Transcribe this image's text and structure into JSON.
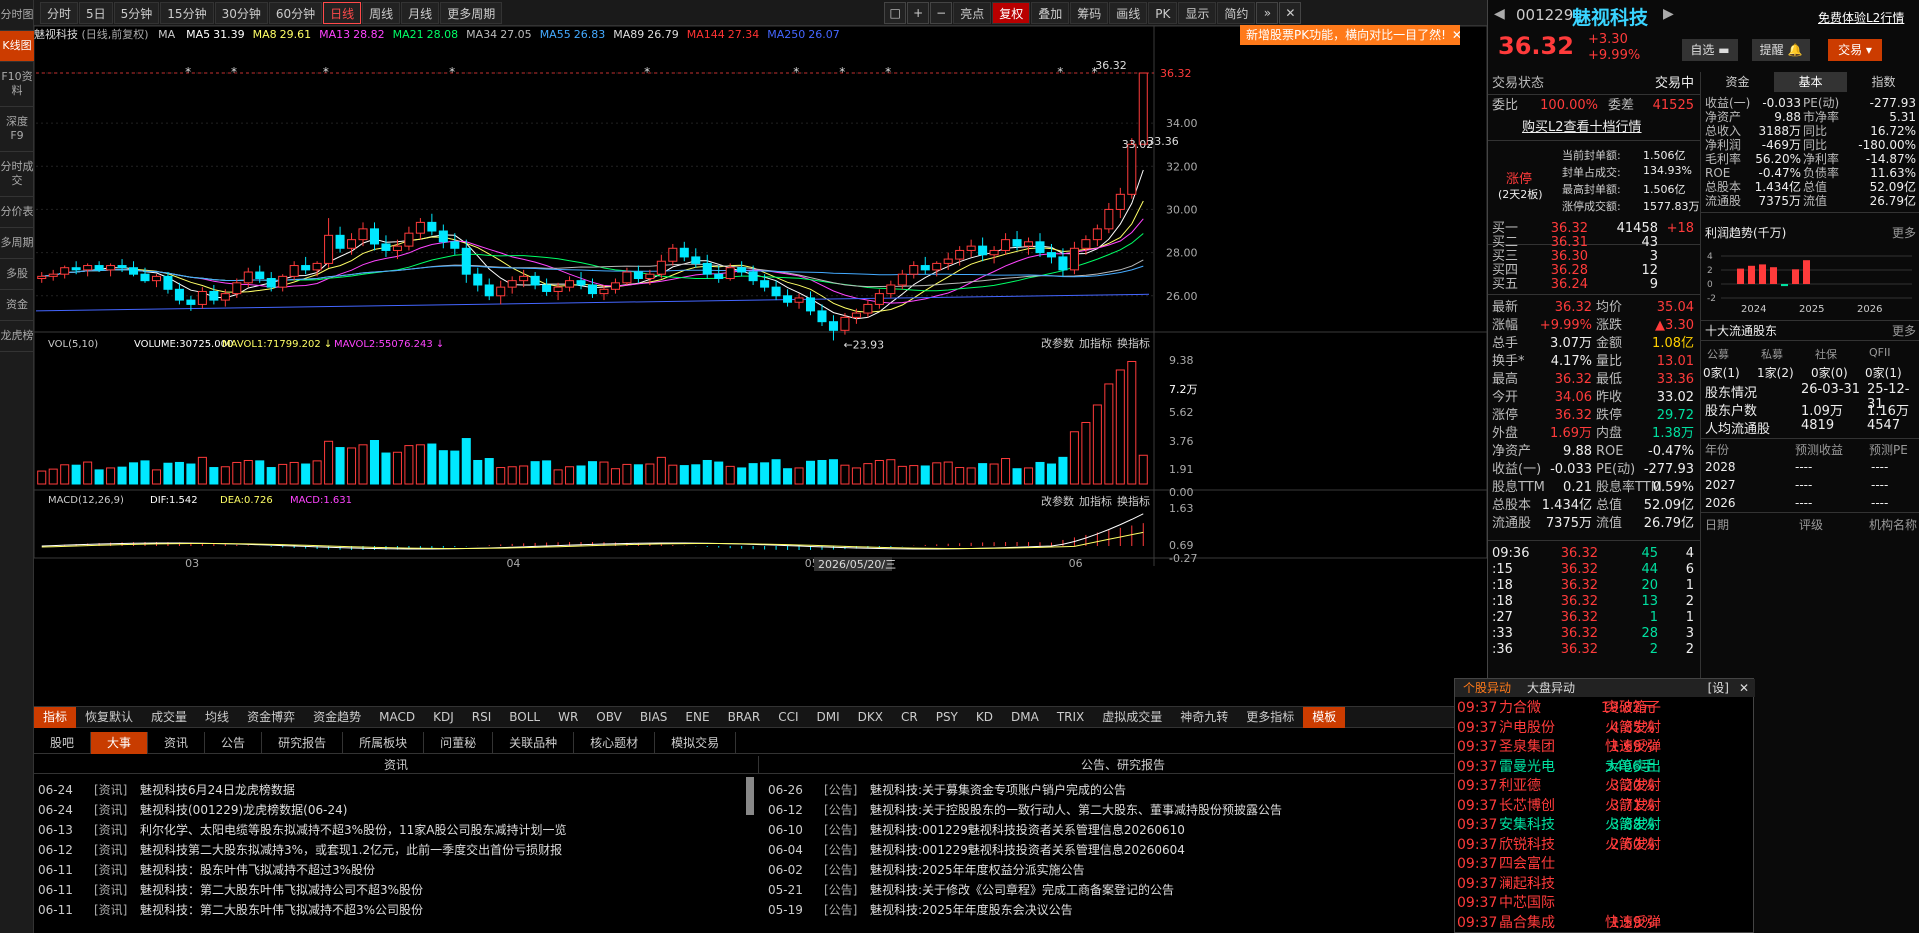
{
  "left_nav": [
    "分时图",
    "K线图",
    "F10资料",
    "深度F9",
    "分时成交",
    "分价表",
    "多周期",
    "多股",
    "资金",
    "龙虎榜"
  ],
  "toolbar": {
    "periods": [
      "分时",
      "5日",
      "5分钟",
      "15分钟",
      "30分钟",
      "60分钟",
      "日线",
      "周线",
      "月线",
      "更多周期"
    ],
    "tools": [
      "亮点",
      "复权",
      "叠加",
      "筹码",
      "画线",
      "PK",
      "显示",
      "简约"
    ]
  },
  "stock": {
    "code": "001229",
    "name": "魅视科技",
    "price": "36.32",
    "change": "+3.30",
    "pct": "+9.99%",
    "trial_link": "免费体验L2行情",
    "watch_btn": "自选",
    "remind_btn": "提醒",
    "trade_btn": "交易"
  },
  "header": {
    "title": "魅视科技",
    "subtitle": "(日线,前复权)",
    "ma": [
      {
        "name": "MA",
        "value": "",
        "color": "#cccccc"
      },
      {
        "name": "MA5",
        "value": "31.39",
        "color": "#ffffff"
      },
      {
        "name": "MA8",
        "value": "29.61",
        "color": "#ffff66"
      },
      {
        "name": "MA13",
        "value": "28.82",
        "color": "#ff44ff"
      },
      {
        "name": "MA21",
        "value": "28.08",
        "color": "#00ff66"
      },
      {
        "name": "MA34",
        "value": "27.05",
        "color": "#bbbbbb"
      },
      {
        "name": "MA55",
        "value": "26.83",
        "color": "#44aaff"
      },
      {
        "name": "MA89",
        "value": "26.79",
        "color": "#dddddd"
      },
      {
        "name": "MA144",
        "value": "27.34",
        "color": "#ff3333"
      },
      {
        "name": "MA250",
        "value": "26.07",
        "color": "#4466ff"
      }
    ],
    "pk_tip": "新增股票PK功能，横向对比一目了然!"
  },
  "colors": {
    "up": "#ff3b3b",
    "down": "#00e8ff",
    "bg": "#000000",
    "accent": "#cc3c00"
  },
  "chart_data": [
    {
      "type": "candlestick",
      "ylim": [
        24.6,
        37.2
      ],
      "yticks": [
        "36.32",
        "34.00",
        "32.00",
        "30.00",
        "28.00",
        "26.00"
      ],
      "annotations": [
        "36.32",
        "33.02",
        "33.36",
        "23.93"
      ],
      "xticks": [
        "03",
        "04",
        "05",
        "06",
        "2026/05/20/三"
      ],
      "ohlc": [
        [
          26.8,
          27.1,
          26.6,
          26.9
        ],
        [
          26.9,
          27.2,
          26.7,
          27
        ],
        [
          27,
          27.4,
          26.8,
          27.3
        ],
        [
          27.3,
          27.6,
          27,
          27.2
        ],
        [
          27.2,
          27.5,
          26.9,
          27.4
        ],
        [
          27.4,
          27.6,
          27.1,
          27.2
        ],
        [
          27.2,
          27.5,
          26.9,
          27.4
        ],
        [
          27.4,
          27.7,
          27.1,
          27.3
        ],
        [
          27.3,
          27.6,
          26.9,
          27
        ],
        [
          27,
          27.3,
          26.6,
          26.7
        ],
        [
          26.7,
          27,
          26.4,
          26.9
        ],
        [
          26.9,
          27.1,
          26.1,
          26.3
        ],
        [
          26.3,
          26.6,
          25.6,
          25.8
        ],
        [
          25.8,
          26,
          25.3,
          25.6
        ],
        [
          25.6,
          26.4,
          25.4,
          26.2
        ],
        [
          26.2,
          26.5,
          25.6,
          25.8
        ],
        [
          25.8,
          26.3,
          25.5,
          26.1
        ],
        [
          26.1,
          26.8,
          25.9,
          26.6
        ],
        [
          26.6,
          27.3,
          26.4,
          27.1
        ],
        [
          27.1,
          27.4,
          26.6,
          26.8
        ],
        [
          26.8,
          27.1,
          26.2,
          26.4
        ],
        [
          26.4,
          27,
          26.2,
          26.9
        ],
        [
          26.9,
          27.6,
          26.7,
          27.4
        ],
        [
          27.4,
          27.8,
          27,
          27.2
        ],
        [
          27.2,
          27.6,
          26.9,
          27.5
        ],
        [
          27.5,
          29.6,
          27.3,
          28.8
        ],
        [
          28.8,
          29.2,
          28,
          28.2
        ],
        [
          28.2,
          28.9,
          27.9,
          28.6
        ],
        [
          28.6,
          29.4,
          28.3,
          29.1
        ],
        [
          29.1,
          29.4,
          28.1,
          28.4
        ],
        [
          28.4,
          28.8,
          27.8,
          28.1
        ],
        [
          28.1,
          28.6,
          27.7,
          28.3
        ],
        [
          28.3,
          29.2,
          28.1,
          28.9
        ],
        [
          28.9,
          29.6,
          28.6,
          29.4
        ],
        [
          29.4,
          29.8,
          28.8,
          29
        ],
        [
          29,
          29.3,
          28.2,
          28.5
        ],
        [
          28.5,
          28.9,
          27.9,
          28.2
        ],
        [
          28.2,
          28.6,
          26.6,
          27
        ],
        [
          27,
          27.3,
          26.2,
          26.5
        ],
        [
          26.5,
          26.8,
          25.8,
          26
        ],
        [
          26,
          26.7,
          25.6,
          26.4
        ],
        [
          26.4,
          26.9,
          26.1,
          26.7
        ],
        [
          26.7,
          27.2,
          26.4,
          26.9
        ],
        [
          26.9,
          27.1,
          26.3,
          26.5
        ],
        [
          26.5,
          26.8,
          26,
          26.2
        ],
        [
          26.2,
          26.6,
          25.8,
          26.4
        ],
        [
          26.4,
          26.9,
          26.2,
          26.7
        ],
        [
          26.7,
          27.1,
          26.3,
          26.5
        ],
        [
          26.5,
          26.8,
          25.9,
          26.1
        ],
        [
          26.1,
          26.5,
          25.8,
          26.3
        ],
        [
          26.3,
          26.8,
          26.1,
          26.6
        ],
        [
          26.6,
          27.3,
          26.5,
          27.1
        ],
        [
          27.1,
          27.4,
          26.6,
          26.8
        ],
        [
          26.8,
          27.2,
          26.5,
          27
        ],
        [
          27,
          27.9,
          26.8,
          27.6
        ],
        [
          27.6,
          28.4,
          27.4,
          28.2
        ],
        [
          28.2,
          28.5,
          27.6,
          27.8
        ],
        [
          27.8,
          28.2,
          27.3,
          27.5
        ],
        [
          27.5,
          27.9,
          26.8,
          27
        ],
        [
          27,
          27.4,
          26.6,
          26.8
        ],
        [
          26.8,
          27.5,
          26.7,
          27.3
        ],
        [
          27.3,
          27.6,
          26.9,
          27.1
        ],
        [
          27.1,
          27.4,
          26.5,
          26.7
        ],
        [
          26.7,
          27,
          26.2,
          26.4
        ],
        [
          26.4,
          26.7,
          25.8,
          26
        ],
        [
          26,
          26.3,
          25.5,
          25.7
        ],
        [
          25.7,
          26.1,
          25.4,
          25.9
        ],
        [
          25.9,
          26.2,
          25.1,
          25.3
        ],
        [
          25.3,
          25.6,
          24.6,
          24.8
        ],
        [
          24.8,
          25.1,
          23.93,
          24.4
        ],
        [
          24.4,
          25.2,
          24.2,
          25
        ],
        [
          25,
          25.4,
          24.7,
          25.2
        ],
        [
          25.2,
          25.8,
          25,
          25.6
        ],
        [
          25.6,
          26.3,
          25.4,
          26.1
        ],
        [
          26.1,
          26.7,
          25.9,
          26.5
        ],
        [
          26.5,
          27.2,
          26.3,
          27
        ],
        [
          27,
          27.6,
          26.8,
          27.4
        ],
        [
          27.4,
          27.8,
          27,
          27.2
        ],
        [
          27.2,
          27.6,
          26.9,
          27.5
        ],
        [
          27.5,
          28,
          27.2,
          27.7
        ],
        [
          27.7,
          28.3,
          27.4,
          28.1
        ],
        [
          28.1,
          28.6,
          27.8,
          28.3
        ],
        [
          28.3,
          28.7,
          27.6,
          27.9
        ],
        [
          27.9,
          28.3,
          27.5,
          28.1
        ],
        [
          28.1,
          28.9,
          27.9,
          28.6
        ],
        [
          28.6,
          29,
          28.1,
          28.3
        ],
        [
          28.3,
          28.7,
          27.9,
          28.5
        ],
        [
          28.5,
          28.9,
          27.8,
          28
        ],
        [
          28,
          28.4,
          27.5,
          27.8
        ],
        [
          27.8,
          28.2,
          26.9,
          27.2
        ],
        [
          27.2,
          28.5,
          27,
          28.2
        ],
        [
          28.2,
          28.8,
          27.9,
          28.6
        ],
        [
          28.6,
          29.3,
          28.3,
          29.1
        ],
        [
          29.1,
          30.3,
          28.9,
          30
        ],
        [
          30,
          31,
          29.6,
          30.7
        ],
        [
          30.7,
          33.3,
          30.5,
          33.02
        ],
        [
          33.02,
          36.32,
          33.02,
          36.32
        ]
      ]
    },
    {
      "type": "bar",
      "title": "VOL(5,10)",
      "series": [
        {
          "name": "VOLUME",
          "value": "30725.000"
        },
        {
          "name": "MAVOL1",
          "value": "71799.202"
        },
        {
          "name": "MAVOL2",
          "value": "55076.243"
        }
      ],
      "yticks": [
        "9.38",
        "7.2万",
        "5.62",
        "3.76",
        "1.91",
        "0.00"
      ]
    },
    {
      "type": "line",
      "title": "MACD(12,26,9)",
      "series": [
        {
          "name": "DIF",
          "value": "1.542"
        },
        {
          "name": "DEA",
          "value": "0.726"
        },
        {
          "name": "MACD",
          "value": "1.631"
        }
      ],
      "yticks": [
        "1.63",
        "0.69",
        "-0.27"
      ]
    }
  ],
  "pane_tools": [
    "改参数",
    "加指标",
    "换指标"
  ],
  "indicator_tabs": [
    "指标",
    "恢复默认",
    "成交量",
    "均线",
    "资金博弈",
    "资金趋势",
    "MACD",
    "KDJ",
    "RSI",
    "BOLL",
    "WR",
    "OBV",
    "BIAS",
    "ENE",
    "BRAR",
    "CCI",
    "DMI",
    "DKX",
    "CR",
    "PSY",
    "KD",
    "DMA",
    "TRIX",
    "虚拟成交量",
    "神奇九转",
    "更多指标",
    "模板"
  ],
  "bottom_tabs": [
    "股吧",
    "大事",
    "资讯",
    "公告",
    "研究报告",
    "所属板块",
    "问董秘",
    "关联品种",
    "核心题材",
    "模拟交易"
  ],
  "news_header": "资讯",
  "notice_header": "公告、研究报告",
  "notice_filter": "公告",
  "news": [
    [
      "06-24",
      "[资讯]",
      "魅视科技6月24日龙虎榜数据"
    ],
    [
      "06-24",
      "[资讯]",
      "魅视科技(001229)龙虎榜数据(06-24)"
    ],
    [
      "06-13",
      "[资讯]",
      "利尔化学、太阳电缆等股东拟减持不超3%股份，11家A股公司股东减持计划一览"
    ],
    [
      "06-12",
      "[资讯]",
      "魅视科技第二大股东拟减持3%，或套现1.2亿元，此前一季度交出首份亏损财报"
    ],
    [
      "06-11",
      "[资讯]",
      "魅视科技：股东叶伟飞拟减持不超过3%股份"
    ],
    [
      "06-11",
      "[资讯]",
      "魅视科技：第二大股东叶伟飞拟减持公司不超3%股份"
    ],
    [
      "06-11",
      "[资讯]",
      "魅视科技：第二大股东叶伟飞拟减持不超3%公司股份"
    ]
  ],
  "notices": [
    [
      "06-26",
      "[公告]",
      "魅视科技:关于募集资金专项账户销户完成的公告"
    ],
    [
      "06-12",
      "[公告]",
      "魅视科技:关于控股股东的一致行动人、第二大股东、董事减持股份预披露公告"
    ],
    [
      "06-10",
      "[公告]",
      "魅视科技:001229魅视科技投资者关系管理信息20260610"
    ],
    [
      "06-04",
      "[公告]",
      "魅视科技:001229魅视科技投资者关系管理信息20260604"
    ],
    [
      "06-02",
      "[公告]",
      "魅视科技:2025年年度权益分派实施公告"
    ],
    [
      "05-21",
      "[公告]",
      "魅视科技:关于修改《公司章程》完成工商备案登记的公告"
    ],
    [
      "05-19",
      "[公告]",
      "魅视科技:2025年年度股东会决议公告"
    ]
  ],
  "trade_status": {
    "label": "交易状态",
    "value": "交易中",
    "weibi_label": "委比",
    "weibi": "100.00%",
    "weicha_label": "委差",
    "weicha": "41525",
    "l2_link": "购买L2查看十档行情"
  },
  "limit_up": {
    "title": "涨停",
    "sub": "(2天2板)",
    "rows": [
      [
        "当前封单额:",
        "1.506亿"
      ],
      [
        "封单占成交:",
        "134.93%"
      ],
      [
        "最高封单额:",
        "1.506亿"
      ],
      [
        "涨停成交额:",
        "1577.83万"
      ]
    ]
  },
  "bids": [
    [
      "买一",
      "36.32",
      "41458",
      "+18"
    ],
    [
      "买二",
      "36.31",
      "43",
      ""
    ],
    [
      "买三",
      "36.30",
      "3",
      ""
    ],
    [
      "买四",
      "36.28",
      "12",
      ""
    ],
    [
      "买五",
      "36.24",
      "9",
      ""
    ]
  ],
  "quote": [
    [
      "最新",
      "36.32",
      "red",
      "均价",
      "35.04",
      "red"
    ],
    [
      "涨幅",
      "+9.99%",
      "red",
      "涨跌",
      "▲3.30",
      "red"
    ],
    [
      "总手",
      "3.07万",
      "white",
      "金额",
      "1.08亿",
      "yel"
    ],
    [
      "换手*",
      "4.17%",
      "white",
      "量比",
      "13.01",
      "red"
    ],
    [
      "最高",
      "36.32",
      "red",
      "最低",
      "33.36",
      "red"
    ],
    [
      "今开",
      "34.06",
      "red",
      "昨收",
      "33.02",
      "white"
    ],
    [
      "涨停",
      "36.32",
      "red",
      "跌停",
      "29.72",
      "green"
    ],
    [
      "外盘",
      "1.69万",
      "red",
      "内盘",
      "1.38万",
      "green"
    ],
    [
      "净资产",
      "9.88",
      "white",
      "ROE",
      "-0.47%",
      "white"
    ],
    [
      "收益(一)",
      "-0.033",
      "white",
      "PE(动)",
      "-277.93",
      "white"
    ],
    [
      "股息TTM",
      "0.21",
      "white",
      "股息率TTM",
      "0.59%",
      "white"
    ],
    [
      "总股本",
      "1.434亿",
      "white",
      "总值",
      "52.09亿",
      "white"
    ],
    [
      "流通股",
      "7375万",
      "white",
      "流值",
      "26.79亿",
      "white"
    ]
  ],
  "ticks": [
    [
      "09:36",
      "36.32",
      "45",
      "4"
    ],
    [
      ":15",
      "36.32",
      "44",
      "6"
    ],
    [
      ":18",
      "36.32",
      "20",
      "1"
    ],
    [
      ":18",
      "36.32",
      "13",
      "2"
    ],
    [
      ":27",
      "36.32",
      "1",
      "1"
    ],
    [
      ":33",
      "36.32",
      "28",
      "3"
    ],
    [
      ":36",
      "36.32",
      "2",
      "2"
    ]
  ],
  "f10_tabs": [
    "资金",
    "基本",
    "指数"
  ],
  "fundamentals": [
    [
      "收益(一)",
      "-0.033",
      "PE(动)",
      "-277.93"
    ],
    [
      "净资产",
      "9.88",
      "市净率",
      "5.31"
    ],
    [
      "总收入",
      "3188万",
      "同比",
      "16.72%"
    ],
    [
      "净利润",
      "-469万",
      "同比",
      "-180.00%"
    ],
    [
      "毛利率",
      "56.20%",
      "净利率",
      "-14.87%"
    ],
    [
      "ROE",
      "-0.47%",
      "负债率",
      "11.63%"
    ],
    [
      "总股本",
      "1.434亿",
      "总值",
      "52.09亿"
    ],
    [
      "流通股",
      "7375万",
      "流值",
      "26.79亿"
    ]
  ],
  "profit_trend": {
    "title": "利润趋势(千万)",
    "more": "更多",
    "years": [
      "2024",
      "2025",
      "2026"
    ],
    "yticks": [
      "4",
      "2",
      "0",
      "-2"
    ],
    "values": [
      2.2,
      2.6,
      2.8,
      2.4,
      -0.3,
      2.1,
      3.4
    ]
  },
  "holders": {
    "title": "十大流通股东",
    "more": "更多",
    "cols": [
      "公募",
      "私募",
      "社保",
      "QFII"
    ],
    "counts": [
      "0家(1)",
      "1家(2)",
      "0家(0)",
      "0家(1)"
    ],
    "rows": [
      [
        "股东情况",
        "26-03-31",
        "25-12-31"
      ],
      [
        "股东户数",
        "1.09万",
        "1.16万"
      ],
      [
        "人均流通股",
        "4819",
        "4547"
      ]
    ]
  },
  "forecast": {
    "cols": [
      "年份",
      "预测收益",
      "预测PE"
    ],
    "rows": [
      [
        "2028",
        "----",
        "----"
      ],
      [
        "2027",
        "----",
        "----"
      ],
      [
        "2026",
        "----",
        "----"
      ]
    ]
  },
  "rating": {
    "cols": [
      "日期",
      "评级",
      "机构名称"
    ]
  },
  "alerts": {
    "tabs": [
      "个股异动",
      "大盘异动"
    ],
    "setting": "[设]",
    "rows": [
      [
        "09:37",
        "力合微",
        "突破箱子",
        "19.82元",
        "red"
      ],
      [
        "09:37",
        "沪电股份",
        "火箭发射",
        "4.85%",
        "red"
      ],
      [
        "09:37",
        "圣泉集团",
        "快速反弹",
        "1.69%",
        "red"
      ],
      [
        "09:37",
        "雷曼光电",
        "大笔卖出",
        "3496手",
        "green"
      ],
      [
        "09:37",
        "利亚德",
        "火箭发射",
        "3.20%",
        "red"
      ],
      [
        "09:37",
        "长芯博创",
        "火箭发射",
        "3.71%",
        "red"
      ],
      [
        "09:37",
        "安集科技",
        "火箭发射",
        "3.88%",
        "green"
      ],
      [
        "09:37",
        "欣锐科技",
        "火箭发射",
        "2.60%",
        "red"
      ],
      [
        "09:37",
        "四会富仕",
        "",
        "",
        " red"
      ],
      [
        "09:37",
        "澜起科技",
        "",
        "",
        "red"
      ],
      [
        "09:37",
        "中芯国际",
        "",
        "",
        "red"
      ],
      [
        "09:37",
        "晶合集成",
        "快速反弹",
        "1.59%",
        "red"
      ]
    ]
  }
}
